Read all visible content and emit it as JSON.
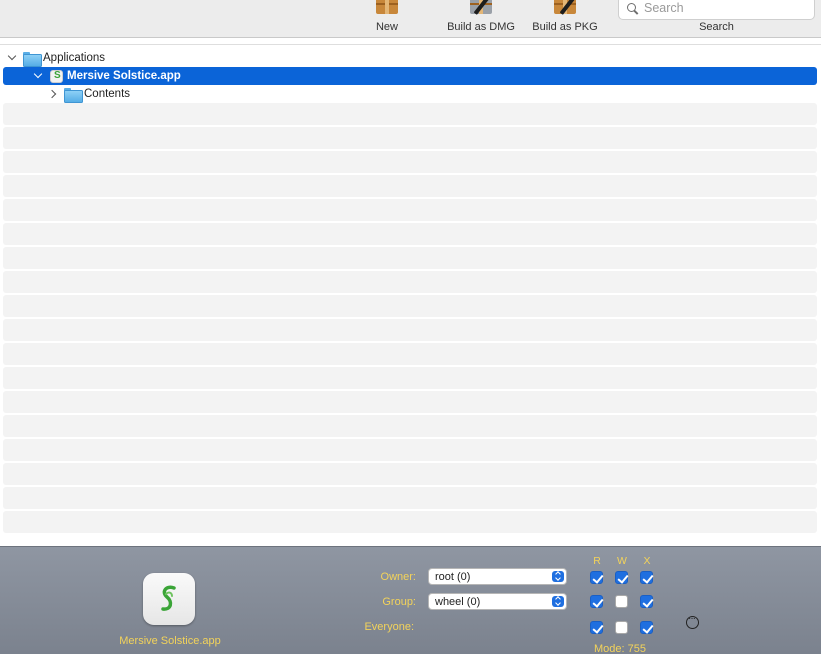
{
  "toolbar": {
    "new_label": "New",
    "build_dmg_label": "Build as DMG",
    "build_pkg_label": "Build as PKG",
    "search_placeholder": "Search",
    "search_label": "Search"
  },
  "outline": {
    "items": [
      {
        "label": "Applications",
        "expanded": true,
        "icon": "folder-icon"
      },
      {
        "label": "Mersive Solstice.app",
        "expanded": true,
        "selected": true,
        "icon": "app-icon"
      },
      {
        "label": "Contents",
        "expanded": false,
        "icon": "folder-icon"
      }
    ]
  },
  "info": {
    "app_name": "Mersive Solstice.app",
    "owner_label": "Owner:",
    "owner_value": "root (0)",
    "group_label": "Group:",
    "group_value": "wheel (0)",
    "everyone_label": "Everyone:",
    "col_r": "R",
    "col_w": "W",
    "col_x": "X",
    "mode_text": "Mode: 755",
    "permissions": {
      "owner": {
        "r": true,
        "w": true,
        "x": true
      },
      "group": {
        "r": true,
        "w": false,
        "x": true
      },
      "everyone": {
        "r": true,
        "w": false,
        "x": true
      }
    }
  },
  "colors": {
    "selection": "#0b64d8",
    "panel_text": "#f3d35a",
    "checkbox_on": "#1f6fe0"
  }
}
